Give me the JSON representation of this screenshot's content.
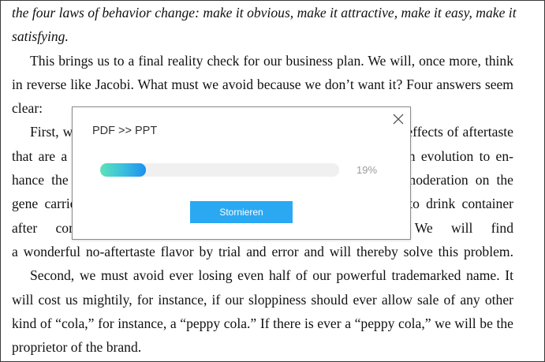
{
  "document": {
    "lines": [
      "the four laws of behavior change: make it obvious, make it attractive, make it easy, make it",
      "satisfying.",
      "This brings us to a final reality check for our business plan. We will, once more, think",
      "in reverse like Jacobi. What must we avoid because we don’t want it? Four answers seem",
      "clear:",
      "First, we must avoid protracted and unpleasant aftertaste. The side-effects of aftertaste",
      "that are a standard part of most soft drinks have been left by human evolution to en-",
      "hance the desire not to drink more. To avoid forcing a kind of moderation on the",
      "gene carriers of soft drinks, we will prevent the aftertaste so that to drink container",
      "after container will not make an adverse aftertaste. We will find",
      "a wonderful no-aftertaste flavor by trial and error and will thereby solve this problem.",
      "Second, we must avoid ever losing even half of our powerful trademarked name. It",
      "will cost us mightily, for instance, if our sloppiness should ever allow sale of any other",
      "kind of “cola,” for instance, a “peppy cola.” If there is ever a “peppy cola,” we will be the",
      "proprietor of the brand."
    ]
  },
  "dialog": {
    "title": "PDF >> PPT",
    "progress": 0.19,
    "progress_label": "19%",
    "cancel_label": "Stornieren",
    "close_icon": "close-icon",
    "accent_color": "#2aa9f2"
  }
}
